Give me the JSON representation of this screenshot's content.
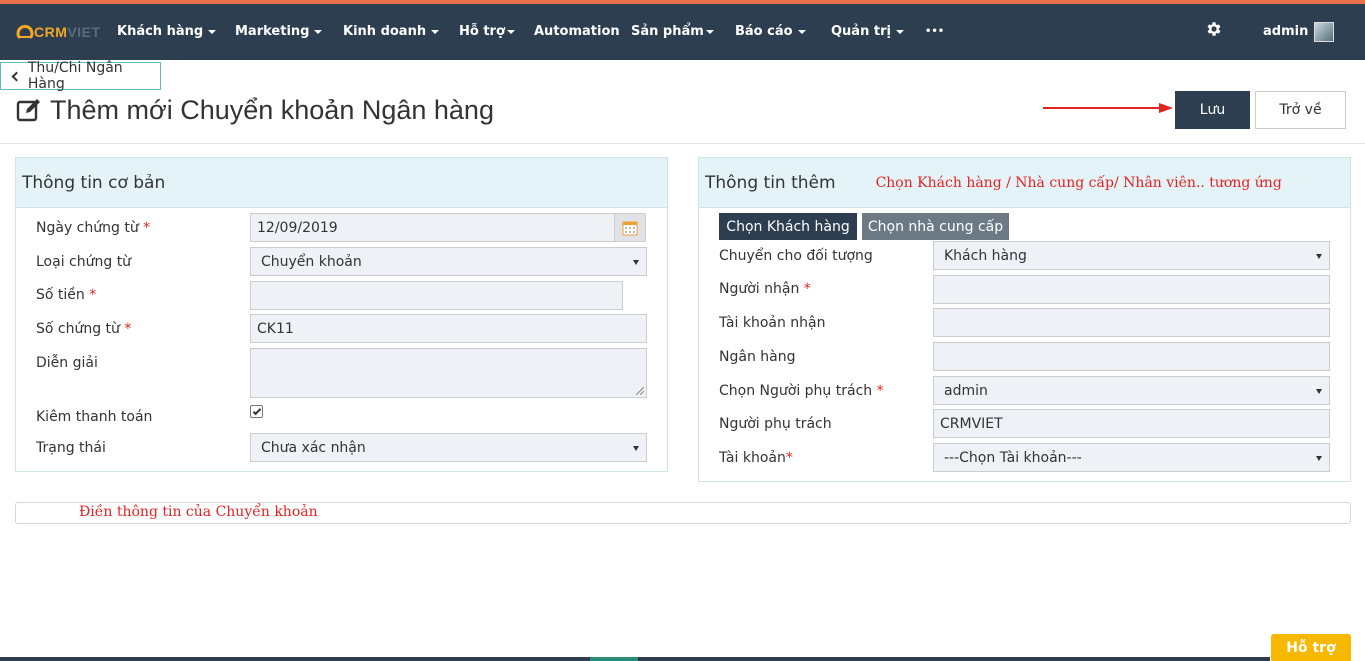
{
  "brand": {
    "logo_text": "CRM",
    "logo_text_dim": "VIET",
    "accent": "#f5a623",
    "nav_bg": "#2c3e50"
  },
  "nav": {
    "items": [
      {
        "label": "Khách hàng",
        "dropdown": true
      },
      {
        "label": "Marketing",
        "dropdown": true
      },
      {
        "label": "Kinh doanh",
        "dropdown": true
      },
      {
        "label": "Hỗ trợ",
        "dropdown": true
      },
      {
        "label": "Automation",
        "dropdown": false
      },
      {
        "label": "Sản phẩm",
        "dropdown": true
      },
      {
        "label": "Báo cáo",
        "dropdown": true
      },
      {
        "label": "Quản trị",
        "dropdown": true
      },
      {
        "label": "•••",
        "dropdown": false
      }
    ],
    "settings_icon": "gear-icon",
    "user": "admin"
  },
  "header": {
    "back_label": "Thu/Chi Ngân Hàng",
    "title": "Thêm mới Chuyển khoản Ngân hàng",
    "save_label": "Lưu",
    "return_label": "Trở về"
  },
  "basic": {
    "heading": "Thông tin cơ bản",
    "date_label": "Ngày chứng từ",
    "date_value": "12/09/2019",
    "type_label": "Loại chứng từ",
    "type_value": "Chuyển khoản",
    "amount_label": "Số tiền",
    "amount_value": "",
    "docno_label": "Số chứng từ",
    "docno_value": "CK11",
    "desc_label": "Diễn giải",
    "desc_value": "",
    "payment_label": "Kiêm thanh toán",
    "payment_checked": true,
    "status_label": "Trạng thái",
    "status_value": "Chưa xác nhận"
  },
  "extra": {
    "heading": "Thông tin thêm",
    "hint": "Chọn Khách hàng / Nhà cung cấp/ Nhân viên.. tương ứng",
    "tab_customer": "Chọn Khách hàng",
    "tab_supplier": "Chọn nhà cung cấp",
    "target_label": "Chuyển cho đối tượng",
    "target_value": "Khách hàng",
    "receiver_label": "Người nhận",
    "receiver_value": "",
    "account_recv_label": "Tài khoản nhận",
    "account_recv_value": "",
    "bank_label": "Ngân hàng",
    "bank_value": "",
    "choose_owner_label": "Chọn Người phụ trách",
    "choose_owner_value": "admin",
    "owner_label": "Người phụ trách",
    "owner_value": "CRMVIET",
    "account_label": "Tài khoản",
    "account_value": "---Chọn Tài khoản---"
  },
  "note": "Điền thông tin của Chuyển khoản",
  "help_label": "Hỗ trợ",
  "required_mark": "*"
}
